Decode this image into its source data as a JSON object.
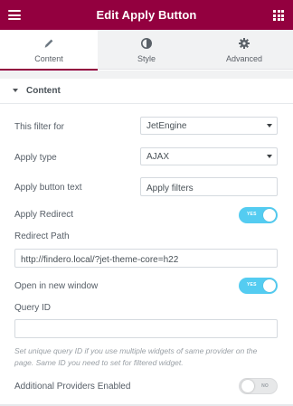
{
  "header": {
    "title": "Edit Apply Button",
    "menu_icon": "hamburger-icon",
    "apps_icon": "grid-icon"
  },
  "tabs": [
    {
      "label": "Content",
      "icon": "pencil-icon",
      "active": true
    },
    {
      "label": "Style",
      "icon": "half-circle-icon",
      "active": false
    },
    {
      "label": "Advanced",
      "icon": "gear-icon",
      "active": false
    }
  ],
  "section": {
    "title": "Content",
    "icon": "caret-down-icon"
  },
  "fields": {
    "filter_for": {
      "label": "This filter for",
      "value": "JetEngine"
    },
    "apply_type": {
      "label": "Apply type",
      "value": "AJAX"
    },
    "apply_button_text": {
      "label": "Apply button text",
      "value": "Apply filters"
    },
    "apply_redirect": {
      "label": "Apply Redirect",
      "state": "YES"
    },
    "redirect_path": {
      "label": "Redirect Path",
      "value": "http://findero.local/?jet-theme-core=h22"
    },
    "open_new_window": {
      "label": "Open in new window",
      "state": "YES"
    },
    "query_id": {
      "label": "Query ID",
      "value": "",
      "hint": "Set unique query ID if you use multiple widgets of same provider on the page. Same ID you need to set for filtered widget."
    },
    "additional_providers": {
      "label": "Additional Providers Enabled",
      "state": "NO"
    }
  },
  "colors": {
    "brand": "#93003f",
    "toggle_on": "#54ccf1",
    "toggle_off": "#e7e8e9"
  }
}
